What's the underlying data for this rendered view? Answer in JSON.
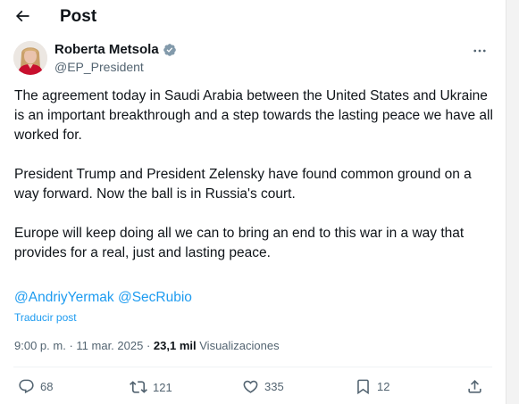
{
  "header": {
    "title": "Post"
  },
  "author": {
    "display_name": "Roberta Metsola",
    "handle": "@EP_President",
    "verified": true
  },
  "tweet": {
    "paragraphs": [
      "The agreement today in Saudi Arabia between the United States and Ukraine is an important breakthrough and a step towards the lasting peace we have all worked for.",
      "President Trump and President Zelensky have found common ground on a way forward. Now the ball is in Russia's court.",
      "Europe will keep doing all we can to bring an end to this war in a way that provides for a real, just and lasting peace."
    ],
    "mentions": [
      "@AndriyYermak",
      "@SecRubio"
    ],
    "translate_label": "Traducir post"
  },
  "meta": {
    "time": "9:00 p. m.",
    "separator": "·",
    "date": "11 mar. 2025",
    "views_count": "23,1 mil",
    "views_label": "Visualizaciones"
  },
  "actions": {
    "replies": "68",
    "reposts": "121",
    "likes": "335",
    "bookmarks": "12"
  },
  "colors": {
    "accent": "#1d9bf0",
    "text": "#0f1419",
    "secondary": "#536471"
  },
  "icons": {
    "back": "arrow-left-icon",
    "verified": "verified-badge-icon",
    "more": "more-horizontal-icon",
    "reply": "reply-icon",
    "repost": "repost-icon",
    "like": "heart-icon",
    "bookmark": "bookmark-icon",
    "share": "share-icon"
  }
}
